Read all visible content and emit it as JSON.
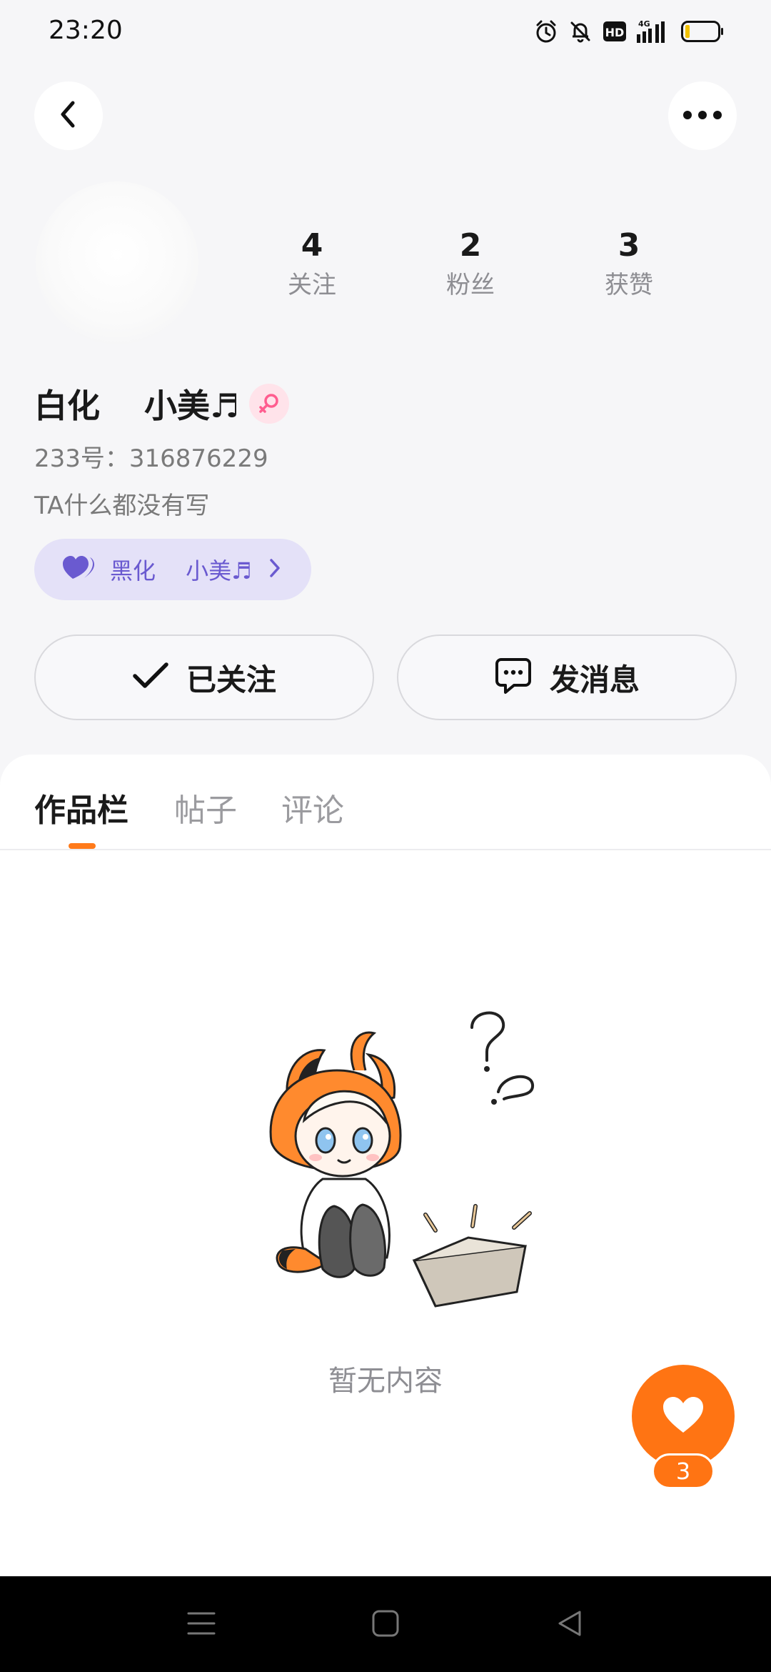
{
  "status_bar": {
    "time": "23:20",
    "network": "4G",
    "hd_label": "HD",
    "icons": [
      "alarm-icon",
      "mute-bell-icon",
      "hd-icon",
      "signal-icon",
      "battery-icon"
    ]
  },
  "header": {
    "back_icon": "chevron-left-icon",
    "more_icon": "more-dots-icon"
  },
  "profile": {
    "nickname": "白化　 小美♬",
    "gender": "female",
    "account_id": "233号：316876229",
    "bio": "TA什么都没有写",
    "stats": {
      "following_value": "4",
      "following_label": "关注",
      "fans_value": "2",
      "fans_label": "粉丝",
      "likes_value": "3",
      "likes_label": "获赞"
    },
    "relation_chip": {
      "text": "黑化　 小美♬",
      "icon": "double-heart-icon"
    },
    "actions": {
      "follow_label": "已关注",
      "message_label": "发消息"
    }
  },
  "tabs": [
    {
      "label": "作品栏",
      "active": true
    },
    {
      "label": "帖子",
      "active": false
    },
    {
      "label": "评论",
      "active": false
    }
  ],
  "empty_state": {
    "text": "暂无内容"
  },
  "like_fab": {
    "count": "3"
  },
  "colors": {
    "accent": "#ff7413",
    "chip_bg": "#e4e1f8",
    "chip_text": "#6a5ad0",
    "page_bg": "#f6f6f8"
  }
}
